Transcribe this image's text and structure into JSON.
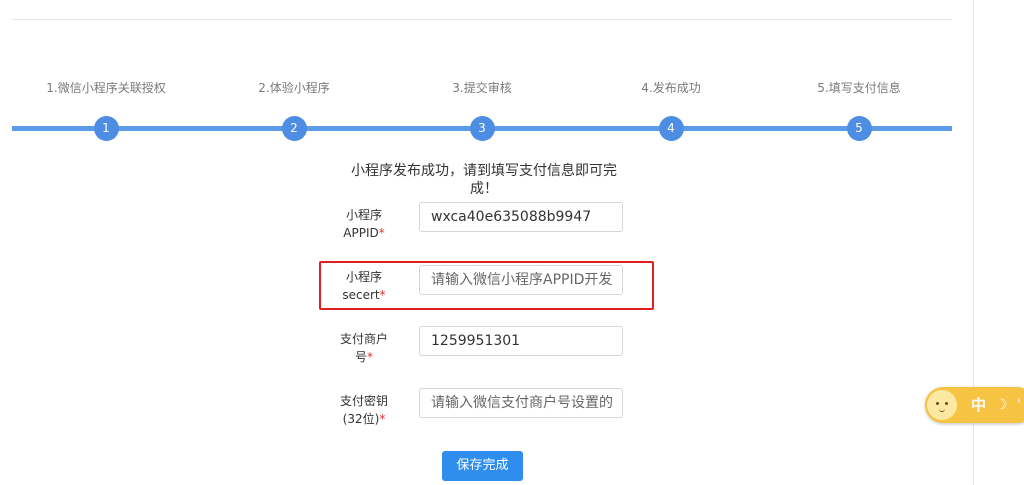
{
  "steps": [
    {
      "label": "1.微信小程序关联授权",
      "number": "1"
    },
    {
      "label": "2.体验小程序",
      "number": "2"
    },
    {
      "label": "3.提交审核",
      "number": "3"
    },
    {
      "label": "4.发布成功",
      "number": "4"
    },
    {
      "label": "5.填写支付信息",
      "number": "5"
    }
  ],
  "colors": {
    "progress": "#5b9be7",
    "circle": "#4d8de3",
    "primary_button": "#2e8ded",
    "required": "#e03131",
    "highlight": "#e02020"
  },
  "notice": {
    "line1": "小程序发布成功，请到填写支付信息即可完",
    "line2": "成！"
  },
  "form": {
    "required_mark": "*",
    "appid": {
      "label1": "小程序",
      "label2": "APPID",
      "value": "wxca40e635088b9947"
    },
    "secret": {
      "label1": "小程序",
      "label2": "secert",
      "placeholder": "请输入微信小程序APPID开发"
    },
    "merchant_id": {
      "label1": "支付商户",
      "label2": "号",
      "value": "1259951301"
    },
    "pay_key": {
      "label1": "支付密钥",
      "label2": "(32位)",
      "placeholder": "请输入微信支付商户号设置的"
    }
  },
  "save_label": "保存完成",
  "widget": {
    "text": "中",
    "moon": "☽",
    "dot": "'",
    "icon": "smiley-face-icon"
  }
}
